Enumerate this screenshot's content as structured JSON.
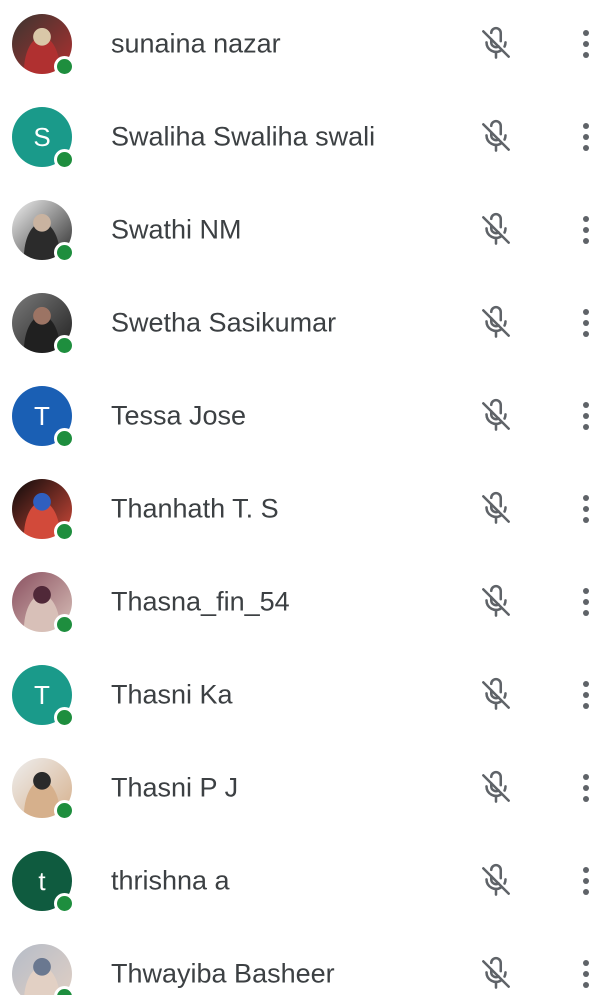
{
  "participants": [
    {
      "name": "sunaina nazar",
      "avatar": {
        "kind": "photo",
        "colors": [
          "#3a3530",
          "#b03030",
          "#d9c7a8"
        ]
      }
    },
    {
      "name": "Swaliha Swaliha swali",
      "avatar": {
        "kind": "letter",
        "letter": "S",
        "bg": "#1a9a8a"
      }
    },
    {
      "name": "Swathi NM",
      "avatar": {
        "kind": "photo",
        "colors": [
          "#f2f2f2",
          "#2b2b2b",
          "#c9b3a0"
        ]
      }
    },
    {
      "name": "Swetha Sasikumar",
      "avatar": {
        "kind": "photo",
        "colors": [
          "#7a7a7a",
          "#202020",
          "#9c7464"
        ]
      }
    },
    {
      "name": "Tessa Jose",
      "avatar": {
        "kind": "letter",
        "letter": "T",
        "bg": "#1a5fb4"
      }
    },
    {
      "name": "Thanhath T. S",
      "avatar": {
        "kind": "photo",
        "colors": [
          "#0a0a0a",
          "#d24a3a",
          "#2f5fbf"
        ]
      }
    },
    {
      "name": "Thasna_fin_54",
      "avatar": {
        "kind": "photo",
        "colors": [
          "#8a5060",
          "#d8c0b8",
          "#502838"
        ]
      }
    },
    {
      "name": "Thasni Ka",
      "avatar": {
        "kind": "letter",
        "letter": "T",
        "bg": "#1a9a8a"
      }
    },
    {
      "name": "Thasni P J",
      "avatar": {
        "kind": "photo",
        "colors": [
          "#eeeeee",
          "#d6b08c",
          "#2a2a2a"
        ]
      }
    },
    {
      "name": "thrishna a",
      "avatar": {
        "kind": "letter",
        "letter": "t",
        "bg": "#0f5b3f"
      }
    },
    {
      "name": "Thwayiba Basheer",
      "avatar": {
        "kind": "photo",
        "colors": [
          "#b5bcc8",
          "#e2d0c4",
          "#6a7890"
        ]
      }
    }
  ],
  "icons": {
    "mic": "mic-off-icon",
    "more": "more-vert-icon"
  },
  "colors": {
    "online": "#1e8e3e",
    "icon": "#5f6368",
    "text": "#3c4043"
  }
}
